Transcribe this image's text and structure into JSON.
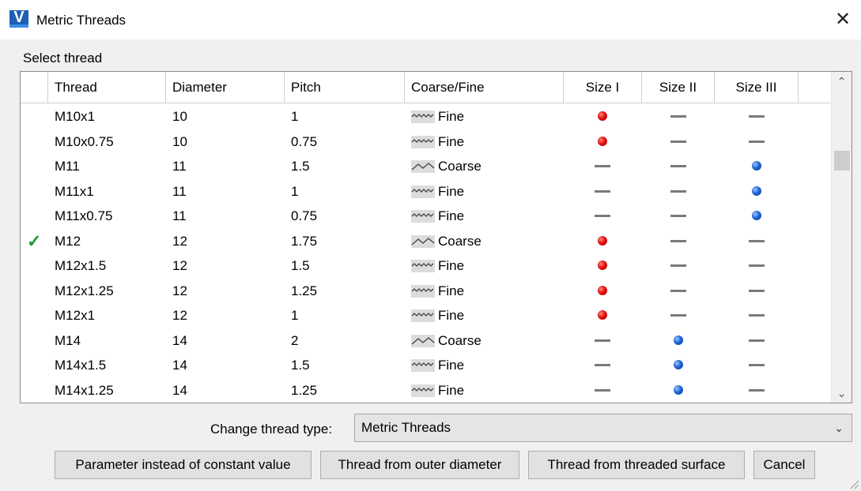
{
  "window": {
    "title": "Metric Threads",
    "app_icon_letter": "V",
    "close_glyph": "✕"
  },
  "select_label": "Select thread",
  "columns": [
    "Thread",
    "Diameter",
    "Pitch",
    "Coarse/Fine",
    "Size I",
    "Size II",
    "Size III"
  ],
  "rows": [
    {
      "thread": "M10x1",
      "diameter": "10",
      "pitch": "1",
      "type": "Fine",
      "s1": "red",
      "s2": "dash",
      "s3": "dash",
      "selected": false
    },
    {
      "thread": "M10x0.75",
      "diameter": "10",
      "pitch": "0.75",
      "type": "Fine",
      "s1": "red",
      "s2": "dash",
      "s3": "dash",
      "selected": false
    },
    {
      "thread": "M11",
      "diameter": "11",
      "pitch": "1.5",
      "type": "Coarse",
      "s1": "dash",
      "s2": "dash",
      "s3": "blue",
      "selected": false
    },
    {
      "thread": "M11x1",
      "diameter": "11",
      "pitch": "1",
      "type": "Fine",
      "s1": "dash",
      "s2": "dash",
      "s3": "blue",
      "selected": false
    },
    {
      "thread": "M11x0.75",
      "diameter": "11",
      "pitch": "0.75",
      "type": "Fine",
      "s1": "dash",
      "s2": "dash",
      "s3": "blue",
      "selected": false
    },
    {
      "thread": "M12",
      "diameter": "12",
      "pitch": "1.75",
      "type": "Coarse",
      "s1": "red",
      "s2": "dash",
      "s3": "dash",
      "selected": true
    },
    {
      "thread": "M12x1.5",
      "diameter": "12",
      "pitch": "1.5",
      "type": "Fine",
      "s1": "red",
      "s2": "dash",
      "s3": "dash",
      "selected": false
    },
    {
      "thread": "M12x1.25",
      "diameter": "12",
      "pitch": "1.25",
      "type": "Fine",
      "s1": "red",
      "s2": "dash",
      "s3": "dash",
      "selected": false
    },
    {
      "thread": "M12x1",
      "diameter": "12",
      "pitch": "1",
      "type": "Fine",
      "s1": "red",
      "s2": "dash",
      "s3": "dash",
      "selected": false
    },
    {
      "thread": "M14",
      "diameter": "14",
      "pitch": "2",
      "type": "Coarse",
      "s1": "dash",
      "s2": "blue",
      "s3": "dash",
      "selected": false
    },
    {
      "thread": "M14x1.5",
      "diameter": "14",
      "pitch": "1.5",
      "type": "Fine",
      "s1": "dash",
      "s2": "blue",
      "s3": "dash",
      "selected": false
    },
    {
      "thread": "M14x1.25",
      "diameter": "14",
      "pitch": "1.25",
      "type": "Fine",
      "s1": "dash",
      "s2": "blue",
      "s3": "dash",
      "selected": false
    }
  ],
  "thread_type": {
    "label": "Change thread type:",
    "value": "Metric Threads"
  },
  "buttons": {
    "parameter": "Parameter instead of constant value",
    "outer": "Thread from outer diameter",
    "surface": "Thread from threaded surface",
    "cancel": "Cancel"
  },
  "colors": {
    "size_i_dot": "#e31010",
    "size_ii_iii_dot": "#1f66d6",
    "check": "#1e9a2c"
  },
  "icons": {
    "selected_marker": "checkmark-icon",
    "fine": "fine-thread-icon",
    "coarse": "coarse-thread-icon"
  }
}
